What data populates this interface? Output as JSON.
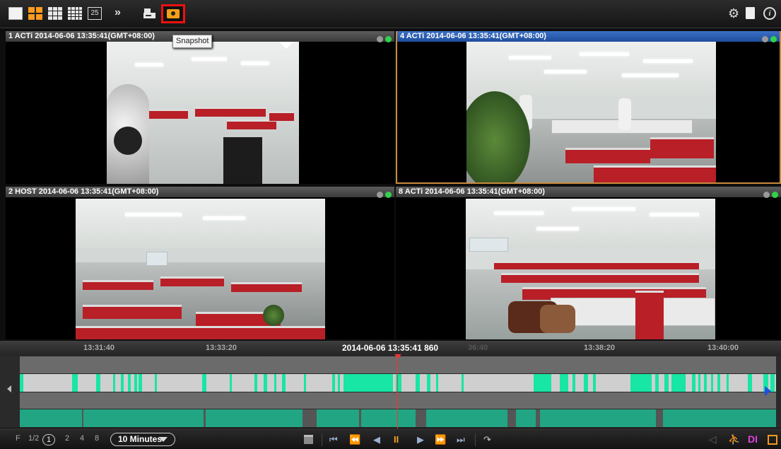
{
  "toolbar": {
    "layout_25_label": "25",
    "more_label": "»",
    "snapshot_tooltip": "Snapshot"
  },
  "panes": [
    {
      "title": "1 ACTi  2014-06-06 13:35:41(GMT+08:00)"
    },
    {
      "title": "4 ACTi  2014-06-06 13:35:41(GMT+08:00)"
    },
    {
      "title": "2 HOST  2014-06-06 13:35:41(GMT+08:00)"
    },
    {
      "title": "8 ACTi  2014-06-06 13:35:41(GMT+08:00)"
    }
  ],
  "timeline": {
    "ticks": [
      "13:31:40",
      "13:33:20",
      "36:40",
      "13:38:20",
      "13:40:00"
    ],
    "current_time": "2014-06-06 13:35:41 860"
  },
  "controls": {
    "frame_label": "F",
    "speeds": [
      "1/2",
      "1",
      "2",
      "4",
      "8"
    ],
    "selected_speed": "1",
    "range": "10 Minutes",
    "buttons": {
      "first": "⏮",
      "rewind": "⏪",
      "step_back": "◀",
      "pause": "II",
      "step_forward": "▶",
      "fast_forward": "⏩",
      "last": "⏭",
      "rotate": "↷"
    },
    "right_icons": {
      "di_label": "DI"
    }
  },
  "colors": {
    "accent_orange": "#ff9b1a",
    "active_title_blue": "#2a5fb4",
    "event_green": "#17e6a4",
    "playhead_red": "#ff3030",
    "snapshot_highlight": "#e11111"
  }
}
